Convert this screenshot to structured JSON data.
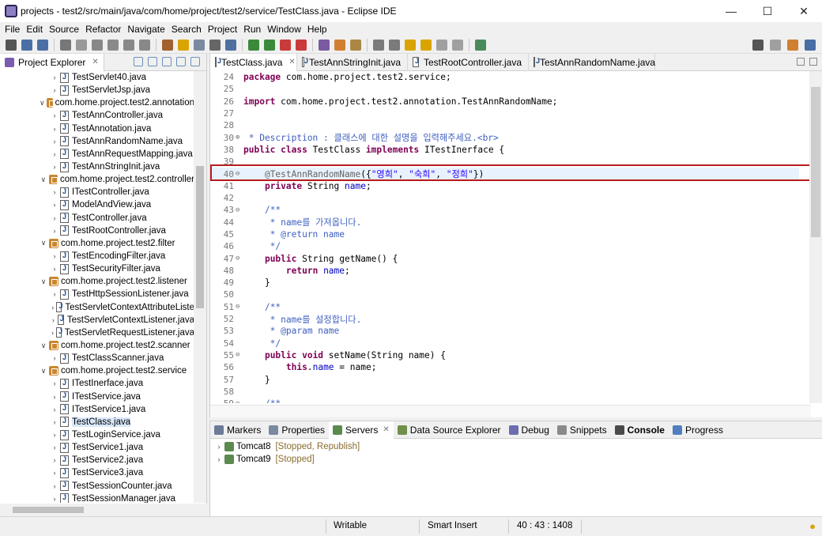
{
  "window": {
    "title": "projects - test2/src/main/java/com/home/project/test2/service/TestClass.java - Eclipse IDE"
  },
  "menu": [
    "File",
    "Edit",
    "Source",
    "Refactor",
    "Navigate",
    "Search",
    "Project",
    "Run",
    "Window",
    "Help"
  ],
  "explorer": {
    "tab_label": "Project Explorer",
    "tree": [
      {
        "label": "TestServlet40.java",
        "type": "file",
        "indent": 64
      },
      {
        "label": "TestServletJsp.java",
        "type": "file",
        "indent": 64
      },
      {
        "label": "com.home.project.test2.annotation",
        "type": "pkg",
        "indent": 50
      },
      {
        "label": "TestAnnController.java",
        "type": "file",
        "indent": 64
      },
      {
        "label": "TestAnnotation.java",
        "type": "file",
        "indent": 64
      },
      {
        "label": "TestAnnRandomName.java",
        "type": "file",
        "indent": 64
      },
      {
        "label": "TestAnnRequestMapping.java",
        "type": "file",
        "indent": 64
      },
      {
        "label": "TestAnnStringInit.java",
        "type": "file",
        "indent": 64
      },
      {
        "label": "com.home.project.test2.controller",
        "type": "pkg",
        "indent": 50
      },
      {
        "label": "ITestController.java",
        "type": "file",
        "indent": 64
      },
      {
        "label": "ModelAndView.java",
        "type": "file",
        "indent": 64
      },
      {
        "label": "TestController.java",
        "type": "file",
        "indent": 64
      },
      {
        "label": "TestRootController.java",
        "type": "file",
        "indent": 64
      },
      {
        "label": "com.home.project.test2.filter",
        "type": "pkg",
        "indent": 50
      },
      {
        "label": "TestEncodingFilter.java",
        "type": "file",
        "indent": 64
      },
      {
        "label": "TestSecurityFilter.java",
        "type": "file",
        "indent": 64
      },
      {
        "label": "com.home.project.test2.listener",
        "type": "pkg",
        "indent": 50
      },
      {
        "label": "TestHttpSessionListener.java",
        "type": "file",
        "indent": 64
      },
      {
        "label": "TestServletContextAttributeListe",
        "type": "file",
        "indent": 64
      },
      {
        "label": "TestServletContextListener.java",
        "type": "file",
        "indent": 64
      },
      {
        "label": "TestServletRequestListener.java",
        "type": "file",
        "indent": 64
      },
      {
        "label": "com.home.project.test2.scanner",
        "type": "pkg",
        "indent": 50
      },
      {
        "label": "TestClassScanner.java",
        "type": "file",
        "indent": 64
      },
      {
        "label": "com.home.project.test2.service",
        "type": "pkg",
        "indent": 50
      },
      {
        "label": "ITestInerface.java",
        "type": "file",
        "indent": 64
      },
      {
        "label": "ITestService.java",
        "type": "file",
        "indent": 64
      },
      {
        "label": "ITestService1.java",
        "type": "file",
        "indent": 64
      },
      {
        "label": "TestClass.java",
        "type": "file",
        "indent": 64,
        "selected": true
      },
      {
        "label": "TestLoginService.java",
        "type": "file",
        "indent": 64
      },
      {
        "label": "TestService1.java",
        "type": "file",
        "indent": 64
      },
      {
        "label": "TestService2.java",
        "type": "file",
        "indent": 64
      },
      {
        "label": "TestService3.java",
        "type": "file",
        "indent": 64
      },
      {
        "label": "TestSessionCounter.java",
        "type": "file",
        "indent": 64
      },
      {
        "label": "TestSessionManager.java",
        "type": "file",
        "indent": 64
      }
    ]
  },
  "editor": {
    "tabs": [
      {
        "label": "TestClass.java",
        "active": true
      },
      {
        "label": "TestAnnStringInit.java"
      },
      {
        "label": "TestRootController.java"
      },
      {
        "label": "TestAnnRandomName.java"
      }
    ],
    "lines": [
      {
        "n": "24",
        "fold": "",
        "html": "<span class=\"kw\">package</span> com.home.project.test2.service;"
      },
      {
        "n": "25",
        "fold": "",
        "html": ""
      },
      {
        "n": "26",
        "fold": "",
        "html": "<span class=\"kw\">import</span> com.home.project.test2.annotation.TestAnnRandomName;"
      },
      {
        "n": "27",
        "fold": "",
        "html": ""
      },
      {
        "n": "28",
        "fold": "",
        "html": ""
      },
      {
        "n": "30",
        "fold": "⊕",
        "html": "<span class=\"cm\"> * Description : 클래스에 대한 설명을 입력해주세요.&lt;br&gt;</span>"
      },
      {
        "n": "38",
        "fold": "",
        "html": "<span class=\"kw\">public class</span> TestClass <span class=\"kw\">implements</span> ITestInerface {"
      },
      {
        "n": "39",
        "fold": "",
        "html": ""
      },
      {
        "n": "40",
        "fold": "⊖",
        "html": "    <span class=\"ann\">@TestAnnRandomName</span>({<span class=\"str\">\"영희\"</span>, <span class=\"str\">\"숙희\"</span>, <span class=\"str\">\"정희\"</span>})",
        "hl": true
      },
      {
        "n": "41",
        "fold": "",
        "html": "    <span class=\"kw\">private</span> String <span class=\"fld\">name</span>;"
      },
      {
        "n": "42",
        "fold": "",
        "html": ""
      },
      {
        "n": "43",
        "fold": "⊖",
        "html": "    <span class=\"cm\">/**</span>"
      },
      {
        "n": "44",
        "fold": "",
        "html": "<span class=\"cm\">     * name를 가져옵니다.</span>"
      },
      {
        "n": "45",
        "fold": "",
        "html": "<span class=\"cm\">     * @return name</span>"
      },
      {
        "n": "46",
        "fold": "",
        "html": "<span class=\"cm\">     */</span>"
      },
      {
        "n": "47",
        "fold": "⊖",
        "html": "    <span class=\"kw\">public</span> String getName() {"
      },
      {
        "n": "48",
        "fold": "",
        "html": "        <span class=\"kw\">return</span> <span class=\"fld\">name</span>;"
      },
      {
        "n": "49",
        "fold": "",
        "html": "    }"
      },
      {
        "n": "50",
        "fold": "",
        "html": ""
      },
      {
        "n": "51",
        "fold": "⊖",
        "html": "    <span class=\"cm\">/**</span>"
      },
      {
        "n": "52",
        "fold": "",
        "html": "<span class=\"cm\">     * name를 설정합니다.</span>"
      },
      {
        "n": "53",
        "fold": "",
        "html": "<span class=\"cm\">     * @param name</span>"
      },
      {
        "n": "54",
        "fold": "",
        "html": "<span class=\"cm\">     */</span>"
      },
      {
        "n": "55",
        "fold": "⊖",
        "html": "    <span class=\"kw\">public void</span> setName(String name) {"
      },
      {
        "n": "56",
        "fold": "",
        "html": "        <span class=\"kw\">this</span>.<span class=\"fld\">name</span> = name;"
      },
      {
        "n": "57",
        "fold": "",
        "html": "    }"
      },
      {
        "n": "58",
        "fold": "",
        "html": ""
      },
      {
        "n": "59",
        "fold": "⊖",
        "html": "    <span class=\"cm\">/**</span>"
      }
    ]
  },
  "bottom": {
    "tabs": [
      {
        "label": "Markers",
        "color": "#6b7b98"
      },
      {
        "label": "Properties",
        "color": "#7a8aa0"
      },
      {
        "label": "Servers",
        "color": "#5b8a4f",
        "active": true
      },
      {
        "label": "Data Source Explorer",
        "color": "#6f8f4a"
      },
      {
        "label": "Debug",
        "color": "#6d6db0"
      },
      {
        "label": "Snippets",
        "color": "#8a8a8a"
      },
      {
        "label": "Console",
        "color": "#4a4a4a",
        "bold": true
      },
      {
        "label": "Progress",
        "color": "#4f7fbf"
      }
    ],
    "servers": [
      {
        "name": "Tomcat8",
        "status": "[Stopped, Republish]"
      },
      {
        "name": "Tomcat9",
        "status": "[Stopped]"
      }
    ]
  },
  "status": {
    "mode": "Writable",
    "insert": "Smart Insert",
    "position": "40 : 43 : 1408"
  },
  "colors": {
    "highlight_box": "#b71c1c",
    "selection": "#d9e8fb"
  }
}
